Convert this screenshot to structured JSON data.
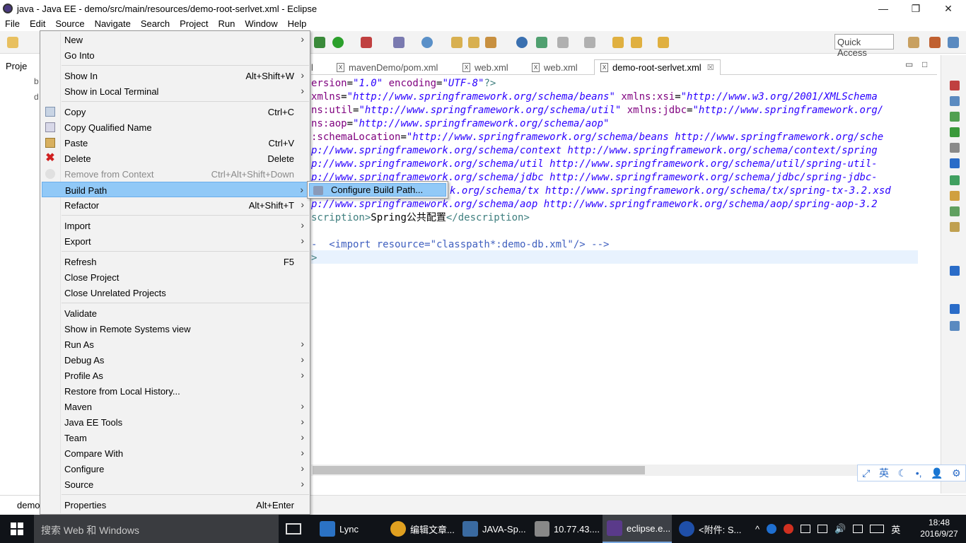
{
  "window": {
    "title": "java - Java EE - demo/src/main/resources/demo-root-serlvet.xml - Eclipse",
    "minimize": "—",
    "maximize": "❐",
    "close": "✕"
  },
  "menubar": [
    "File",
    "Edit",
    "Source",
    "Navigate",
    "Search",
    "Project",
    "Run",
    "Window",
    "Help"
  ],
  "quick_access": {
    "placeholder": "Quick Access"
  },
  "explorer": {
    "title": "Proje",
    "rows": [
      "b",
      "d"
    ],
    "bottom_label": "demo"
  },
  "editor": {
    "tabs": [
      {
        "label": "l",
        "active": false
      },
      {
        "label": "mavenDemo/pom.xml",
        "active": false
      },
      {
        "label": "web.xml",
        "active": false
      },
      {
        "label": "web.xml",
        "active": false
      },
      {
        "label": "demo-root-serlvet.xml",
        "active": true
      }
    ],
    "close_glyph": "☒",
    "minimize_glyph": "▭",
    "maximize_glyph": "□",
    "code": [
      {
        "plain": "",
        "attr": "ersion",
        "eq": "=",
        "str": "\"1.0\"",
        "rest_attr": " encoding",
        "rest_eq": "=",
        "rest_str": "\"UTF-8\"",
        "tail": "?>"
      },
      {
        "attr": "xmlns",
        "str": "\"http://www.springframework.org/schema/beans\"",
        "attr2": " xmlns:xsi",
        "str2": "\"http://www.w3.org/2001/XMLSchema"
      },
      {
        "attr": "ns:util",
        "str": "\"http://www.springframework.org/schema/util\"",
        "attr2": " xmlns:jdbc",
        "str2": "\"http://www.springframework.org/"
      },
      {
        "attr": "ns:aop",
        "str": "\"http://www.springframework.org/schema/aop\"",
        "attr2": "",
        "str2": ""
      },
      {
        "attr": ":schemaLocation",
        "str": "\"http://www.springframework.org/schema/beans http://www.springframework.org/sche",
        "attr2": "",
        "str2": ""
      },
      {
        "str_only": "p://www.springframework.org/schema/context http://www.springframework.org/schema/context/spring"
      },
      {
        "str_only": "p://www.springframework.org/schema/util http://www.springframework.org/schema/util/spring-util-"
      },
      {
        "str_only": "p://www.springframework.org/schema/jdbc http://www.springframework.org/schema/jdbc/spring-jdbc-"
      },
      {
        "str_only": "k.org/schema/tx http://www.springframework.org/schema/tx/spring-tx-3.2.xsd"
      },
      {
        "str_only": "p://www.springframework.org/schema/aop http://www.springframework.org/schema/aop/spring-aop-3.2"
      },
      {
        "tag_open": "scription>",
        "text": "Spring公共配置",
        "tag_close": "</description>"
      },
      {
        "blank": ""
      },
      {
        "comment": "-  <import resource=\"classpath*:demo-db.xml\"/> -->"
      },
      {
        "tag_open": ">",
        "text": "",
        "tag_close": ""
      }
    ]
  },
  "context_menu": {
    "items": [
      {
        "label": "New",
        "shortcut": "",
        "submenu": true,
        "icon": "",
        "disabled": false
      },
      {
        "label": "Go Into",
        "shortcut": "",
        "submenu": false,
        "icon": "",
        "disabled": false
      },
      {
        "label": "Show In",
        "shortcut": "Alt+Shift+W",
        "submenu": true,
        "icon": "",
        "disabled": false
      },
      {
        "label": "Show in Local Terminal",
        "shortcut": "",
        "submenu": true,
        "icon": "",
        "disabled": false
      },
      {
        "label": "Copy",
        "shortcut": "Ctrl+C",
        "submenu": false,
        "icon": "copy-icon",
        "disabled": false
      },
      {
        "label": "Copy Qualified Name",
        "shortcut": "",
        "submenu": false,
        "icon": "copy-qualified-icon",
        "disabled": false
      },
      {
        "label": "Paste",
        "shortcut": "Ctrl+V",
        "submenu": false,
        "icon": "paste-icon",
        "disabled": false
      },
      {
        "label": "Delete",
        "shortcut": "Delete",
        "submenu": false,
        "icon": "delete-icon",
        "disabled": false
      },
      {
        "label": "Remove from Context",
        "shortcut": "Ctrl+Alt+Shift+Down",
        "submenu": false,
        "icon": "remove-context-icon",
        "disabled": true
      },
      {
        "label": "Build Path",
        "shortcut": "",
        "submenu": true,
        "icon": "",
        "disabled": false
      },
      {
        "label": "Refactor",
        "shortcut": "Alt+Shift+T",
        "submenu": true,
        "icon": "",
        "disabled": false
      },
      {
        "label": "Import",
        "shortcut": "",
        "submenu": true,
        "icon": "",
        "disabled": false
      },
      {
        "label": "Export",
        "shortcut": "",
        "submenu": true,
        "icon": "",
        "disabled": false
      },
      {
        "label": "Refresh",
        "shortcut": "F5",
        "submenu": false,
        "icon": "",
        "disabled": false
      },
      {
        "label": "Close Project",
        "shortcut": "",
        "submenu": false,
        "icon": "",
        "disabled": false
      },
      {
        "label": "Close Unrelated Projects",
        "shortcut": "",
        "submenu": false,
        "icon": "",
        "disabled": false
      },
      {
        "label": "Validate",
        "shortcut": "",
        "submenu": false,
        "icon": "",
        "disabled": false
      },
      {
        "label": "Show in Remote Systems view",
        "shortcut": "",
        "submenu": false,
        "icon": "",
        "disabled": false
      },
      {
        "label": "Run As",
        "shortcut": "",
        "submenu": true,
        "icon": "",
        "disabled": false
      },
      {
        "label": "Debug As",
        "shortcut": "",
        "submenu": true,
        "icon": "",
        "disabled": false
      },
      {
        "label": "Profile As",
        "shortcut": "",
        "submenu": true,
        "icon": "",
        "disabled": false
      },
      {
        "label": "Restore from Local History...",
        "shortcut": "",
        "submenu": false,
        "icon": "",
        "disabled": false
      },
      {
        "label": "Maven",
        "shortcut": "",
        "submenu": true,
        "icon": "",
        "disabled": false
      },
      {
        "label": "Java EE Tools",
        "shortcut": "",
        "submenu": true,
        "icon": "",
        "disabled": false
      },
      {
        "label": "Team",
        "shortcut": "",
        "submenu": true,
        "icon": "",
        "disabled": false
      },
      {
        "label": "Compare With",
        "shortcut": "",
        "submenu": true,
        "icon": "",
        "disabled": false
      },
      {
        "label": "Configure",
        "shortcut": "",
        "submenu": true,
        "icon": "",
        "disabled": false
      },
      {
        "label": "Source",
        "shortcut": "",
        "submenu": true,
        "icon": "",
        "disabled": false
      },
      {
        "label": "Properties",
        "shortcut": "Alt+Enter",
        "submenu": false,
        "icon": "",
        "disabled": false
      }
    ],
    "highlighted": "Build Path",
    "submenu_arrow": "›"
  },
  "submenu": {
    "label": "Configure Build Path..."
  },
  "ime": {
    "lang": "英",
    "moon": "☾",
    "dots": "•,",
    "user": "👤",
    "gear": "⚙"
  },
  "taskbar": {
    "search_placeholder": "搜索 Web 和 Windows",
    "apps": [
      {
        "label": "Lync",
        "color": "#2b72c4"
      },
      {
        "label": "编辑文章...",
        "color": "#e0a020"
      },
      {
        "label": "JAVA-Sp...",
        "color": "#3a6aa0"
      },
      {
        "label": "10.77.43....",
        "color": "#888888"
      },
      {
        "label": "eclipse.e...",
        "color": "#5a3a8a"
      },
      {
        "label": "<附件: S...",
        "color": "#1f4fa8"
      }
    ],
    "tray_lang": "英",
    "tray_chevron": "^",
    "clock_time": "18:48",
    "clock_date": "2016/9/27"
  }
}
